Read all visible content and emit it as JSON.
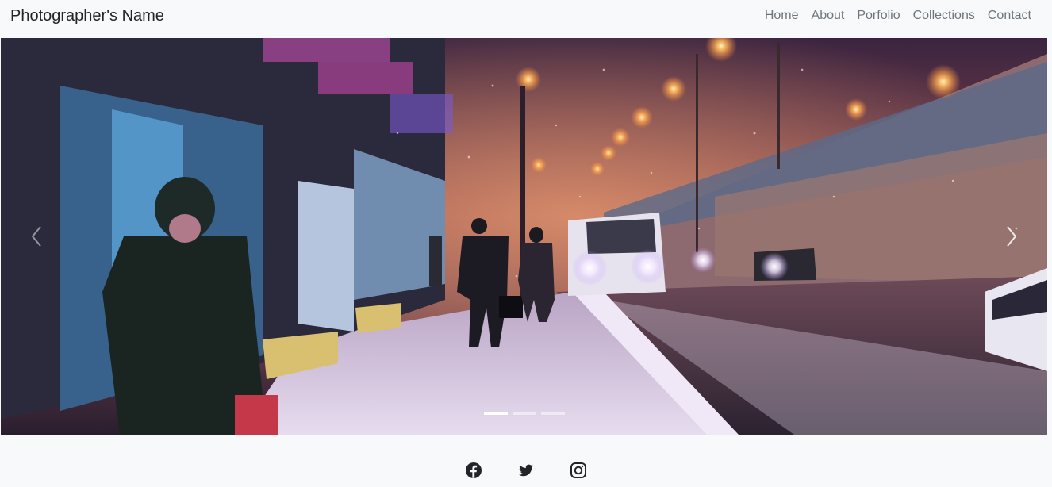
{
  "navbar": {
    "brand": "Photographer's Name",
    "links": [
      "Home",
      "About",
      "Porfolio",
      "Collections",
      "Contact"
    ]
  },
  "carousel": {
    "slide_count": 3,
    "active_index": 0,
    "prev_icon": "chevron-left-icon",
    "next_icon": "chevron-right-icon"
  },
  "footer": {
    "social_icons": [
      "facebook-icon",
      "twitter-icon",
      "instagram-icon"
    ]
  },
  "colors": {
    "nav_background": "#f8f9fa",
    "brand_text": "#212529",
    "nav_link": "#6c757d",
    "street_light": "#ffb45a",
    "night_sky": "#3a2438"
  }
}
